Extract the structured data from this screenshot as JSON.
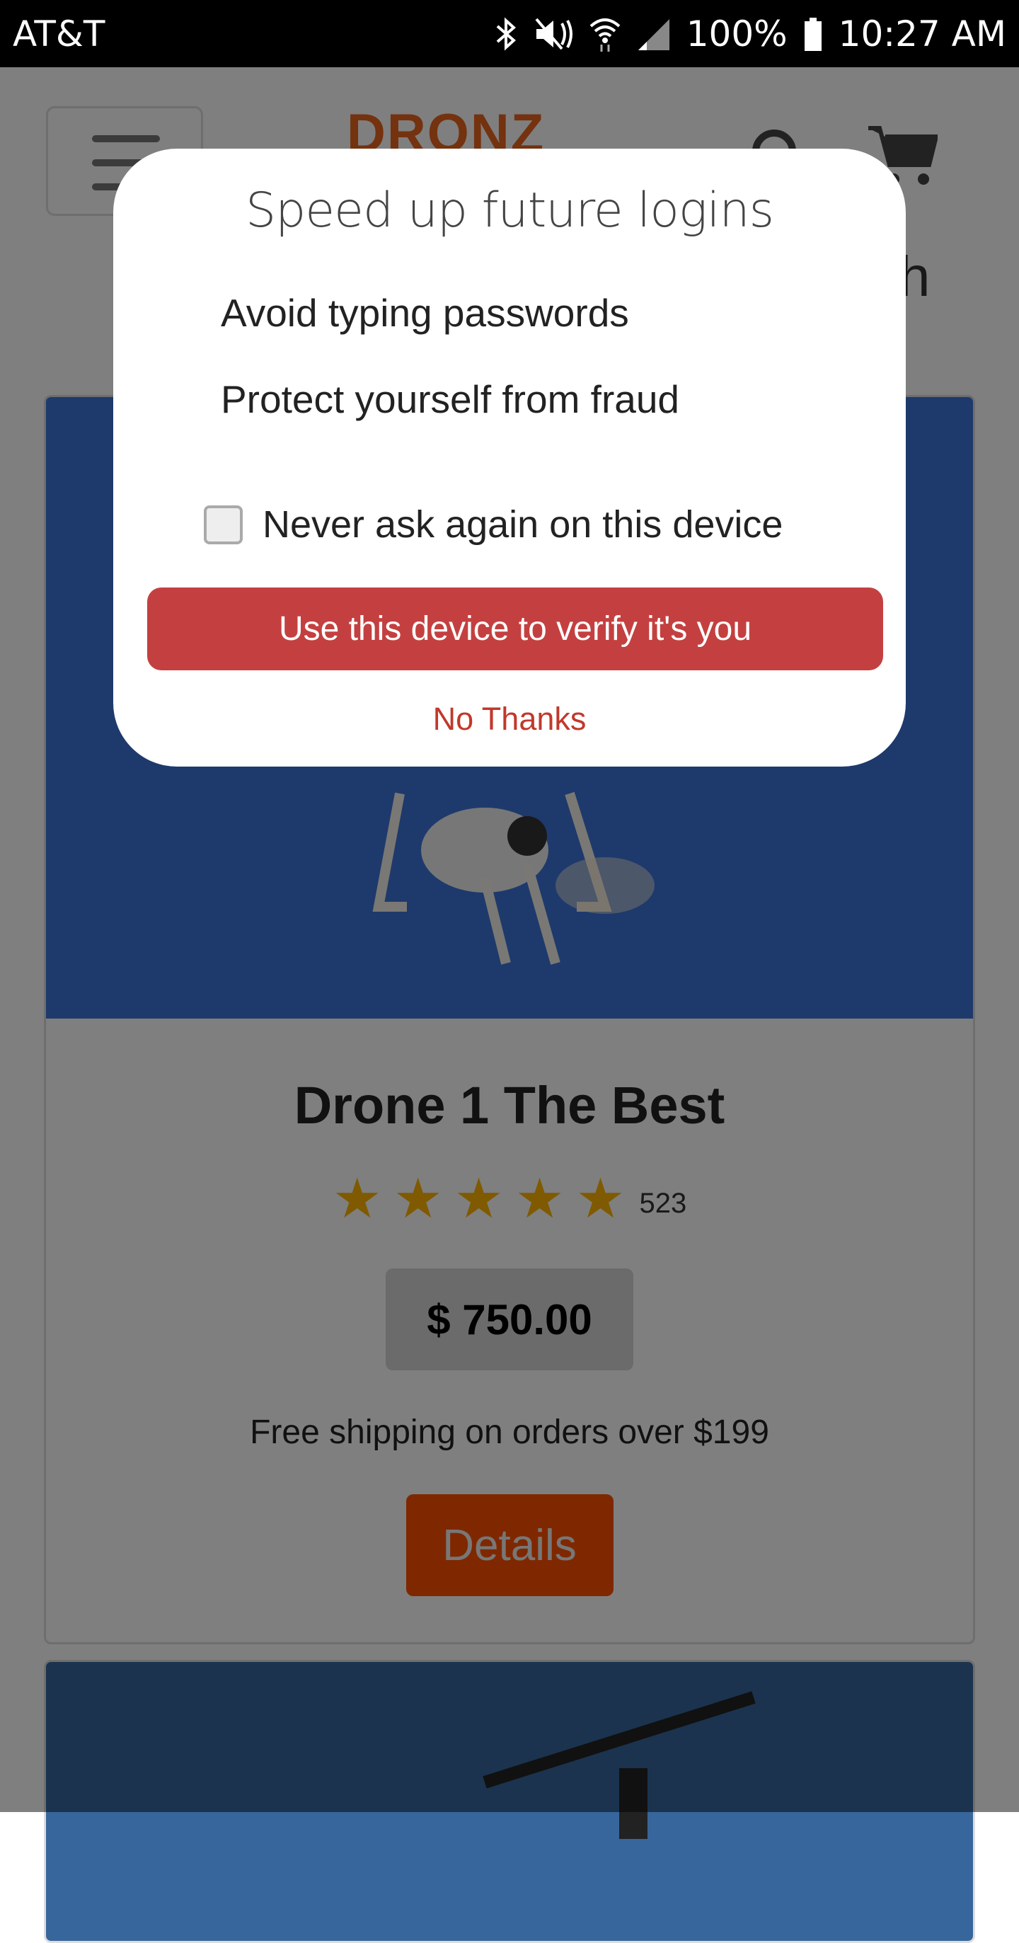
{
  "status_bar": {
    "carrier": "AT&T",
    "battery": "100%",
    "time": "10:27 AM",
    "icons": [
      "bluetooth-icon",
      "mute-icon",
      "wifi-icon",
      "signal-icon",
      "battery-icon"
    ]
  },
  "header": {
    "logo": "DRONZ",
    "search_label_partial": "h"
  },
  "products": [
    {
      "title": "Drone 1 The Best",
      "rating": 5,
      "rating_count": "523",
      "price": "$ 750.00",
      "shipping": "Free shipping on orders over $199",
      "details_label": "Details"
    }
  ],
  "dialog": {
    "title": "Speed up future logins",
    "benefits": [
      "Avoid typing passwords",
      "Protect yourself from fraud"
    ],
    "never_ask_label": "Never ask again on this device",
    "never_ask_checked": false,
    "verify_label": "Use this device to verify it's you",
    "no_thanks_label": "No Thanks"
  },
  "colors": {
    "accent": "#c44040",
    "details_button": "#ff5000",
    "star": "#ffb400",
    "logo": "#e8641e"
  }
}
